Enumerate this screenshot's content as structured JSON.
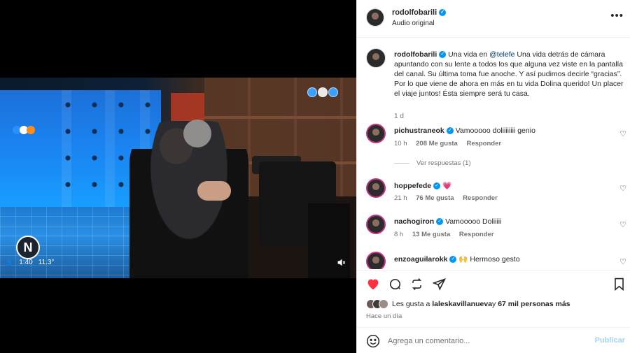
{
  "post": {
    "username": "rodolfobarili",
    "audio": "Audio original",
    "more_icon": "more-horizontal-icon"
  },
  "video": {
    "overlay_time": "1:40",
    "overlay_temp": "11.3°",
    "channel_badge": "N",
    "brand_colors": [
      "#2b8fff",
      "#ffffff",
      "#ff8c1a"
    ]
  },
  "caption": {
    "username": "rodolfobarili",
    "text_before": "Una vida en ",
    "mention": "@telefe",
    "text_after": " Una vida detrás de cámara apuntando con su lente a todos los que alguna vez viste en la pantalla del canal. Su última toma fue anoche. Y así pudimos decirle “gracias”. Por lo que viene de ahora en más en tu vida Dolina querido! Un placer el viaje juntos! Ésta siempre será tu casa.",
    "time": "1 d"
  },
  "comments": [
    {
      "user": "pichustraneok",
      "text": "Vamooooo doliiiiiiii genio",
      "time": "10 h",
      "likes": "208 Me gusta",
      "reply": "Responder"
    },
    {
      "user": "hoppefede",
      "text": "💗",
      "time": "21 h",
      "likes": "76 Me gusta",
      "reply": "Responder"
    },
    {
      "user": "nachogiron",
      "text": "Vamooooo Doliiiii",
      "time": "8 h",
      "likes": "13 Me gusta",
      "reply": "Responder"
    },
    {
      "user": "enzoaguilarokk",
      "text": "🙌 Hermoso gesto"
    }
  ],
  "replies_link": "Ver respuestas (1)",
  "likes": {
    "prefix": "Les gusta a ",
    "user": "laleskavillanueva",
    "middle": " y ",
    "count": "67 mil personas más"
  },
  "posted_ago": "Hace un día",
  "composer": {
    "placeholder": "Agrega un comentario...",
    "publish": "Publicar"
  },
  "colors": {
    "like_red": "#ff3040",
    "link_blue": "#00376b",
    "publish_disabled": "#a5d4f8",
    "verified_blue": "#0095f6"
  }
}
